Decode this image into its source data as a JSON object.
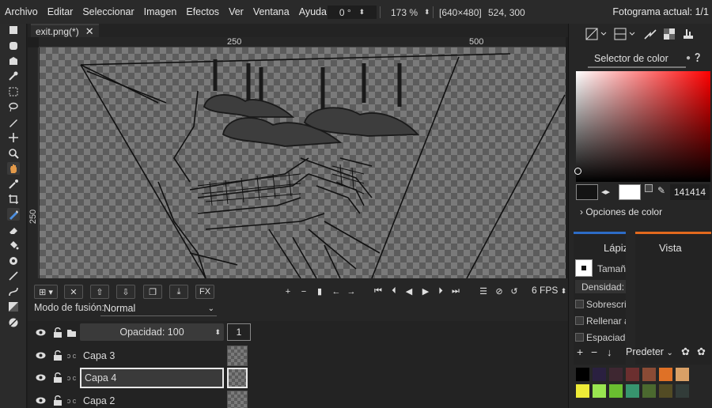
{
  "menubar": {
    "items": [
      "Archivo",
      "Editar",
      "Seleccionar",
      "Imagen",
      "Efectos",
      "Ver",
      "Ventana",
      "Ayuda"
    ],
    "rotation": "0 °",
    "zoom": "173 %",
    "canvas_size": "[640×480]",
    "cursor_pos": "524, 300",
    "frame": "Fotograma actual: 1/1"
  },
  "document": {
    "tab_title": "exit.png(*)"
  },
  "rulers": {
    "top": [
      "250",
      "500"
    ],
    "left": [
      "250"
    ]
  },
  "layer_toolbar": {
    "fx_label": "FX",
    "blend_label": "Modo de fusión:",
    "blend_value": "Normal",
    "fps": "6 FPS"
  },
  "layers": {
    "opacity": "Opacidad: 100",
    "frame_number": "1",
    "items": [
      {
        "name": "Capa 3",
        "active": false
      },
      {
        "name": "Capa 4",
        "active": true
      },
      {
        "name": "Capa 2",
        "active": false
      }
    ]
  },
  "color_picker": {
    "title": "Selector de color",
    "hex": "141414",
    "options_label": "Opciones de color",
    "primary": "#141414",
    "secondary": "#ffffff"
  },
  "tool_options": {
    "title": "Lápiz",
    "shape_label": "Tamaño",
    "density": "Densidad:",
    "checks": [
      "Sobrescribir",
      "Rellenar área"
    ],
    "spacing": "Espaciado"
  },
  "view_panel": {
    "title": "Vista"
  },
  "palette": {
    "name": "Predeter",
    "colors": [
      "#000000",
      "#2a2040",
      "#3e2731",
      "#6b2f2f",
      "#8a4b35",
      "#df7126",
      "#d9a066",
      "#eeeb37",
      "#99e550",
      "#6abe30",
      "#37946e",
      "#4b692f",
      "#524b24",
      "#323c39"
    ]
  }
}
